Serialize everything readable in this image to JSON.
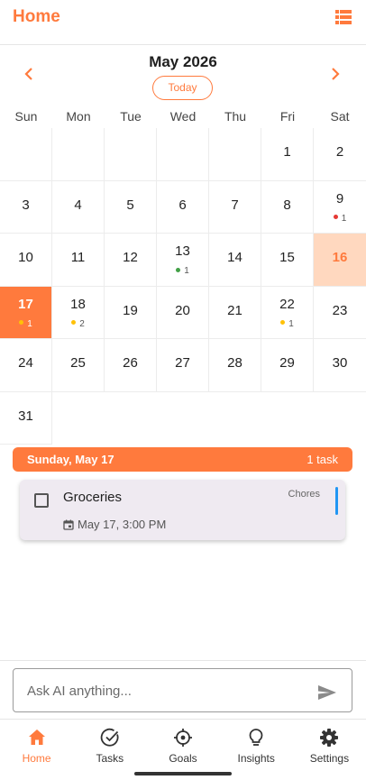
{
  "header": {
    "title": "Home",
    "list_icon": "list-view-icon"
  },
  "calendar": {
    "month_label": "May 2026",
    "today_label": "Today",
    "weekdays": [
      "Sun",
      "Mon",
      "Tue",
      "Wed",
      "Thu",
      "Fri",
      "Sat"
    ],
    "weeks": [
      [
        null,
        null,
        null,
        null,
        null,
        {
          "day": "1"
        },
        {
          "day": "2"
        }
      ],
      [
        {
          "day": "3"
        },
        {
          "day": "4"
        },
        {
          "day": "5"
        },
        {
          "day": "6"
        },
        {
          "day": "7"
        },
        {
          "day": "8"
        },
        {
          "day": "9",
          "count": "1",
          "dot": "#e53935"
        }
      ],
      [
        {
          "day": "10"
        },
        {
          "day": "11"
        },
        {
          "day": "12"
        },
        {
          "day": "13",
          "count": "1",
          "dot": "#43a047"
        },
        {
          "day": "14"
        },
        {
          "day": "15"
        },
        {
          "day": "16",
          "today": true
        }
      ],
      [
        {
          "day": "17",
          "count": "1",
          "dot": "#ffc107",
          "selected": true
        },
        {
          "day": "18",
          "count": "2",
          "dot": "#ffc107"
        },
        {
          "day": "19"
        },
        {
          "day": "20"
        },
        {
          "day": "21"
        },
        {
          "day": "22",
          "count": "1",
          "dot": "#ffc107"
        },
        {
          "day": "23"
        }
      ],
      [
        {
          "day": "24"
        },
        {
          "day": "25"
        },
        {
          "day": "26"
        },
        {
          "day": "27"
        },
        {
          "day": "28"
        },
        {
          "day": "29"
        },
        {
          "day": "30"
        }
      ],
      [
        {
          "day": "31"
        },
        null,
        null,
        null,
        null,
        null,
        null
      ]
    ]
  },
  "selected_day": {
    "date_label": "Sunday, May 17",
    "count_label": "1 task",
    "tasks": [
      {
        "name": "Groceries",
        "category": "Chores",
        "due": "May 17, 3:00 PM",
        "accent": "#2196f3"
      }
    ]
  },
  "ai": {
    "placeholder": "Ask AI anything...",
    "send_icon": "send-icon"
  },
  "nav": [
    {
      "label": "Home",
      "icon": "home-icon",
      "active": true
    },
    {
      "label": "Tasks",
      "icon": "check-circle-icon",
      "active": false
    },
    {
      "label": "Goals",
      "icon": "target-icon",
      "active": false
    },
    {
      "label": "Insights",
      "icon": "lightbulb-icon",
      "active": false
    },
    {
      "label": "Settings",
      "icon": "gear-icon",
      "active": false
    }
  ],
  "colors": {
    "accent": "#ff7a3d",
    "today_bg": "#ffd8bf",
    "task_card": "#efeaf1"
  }
}
